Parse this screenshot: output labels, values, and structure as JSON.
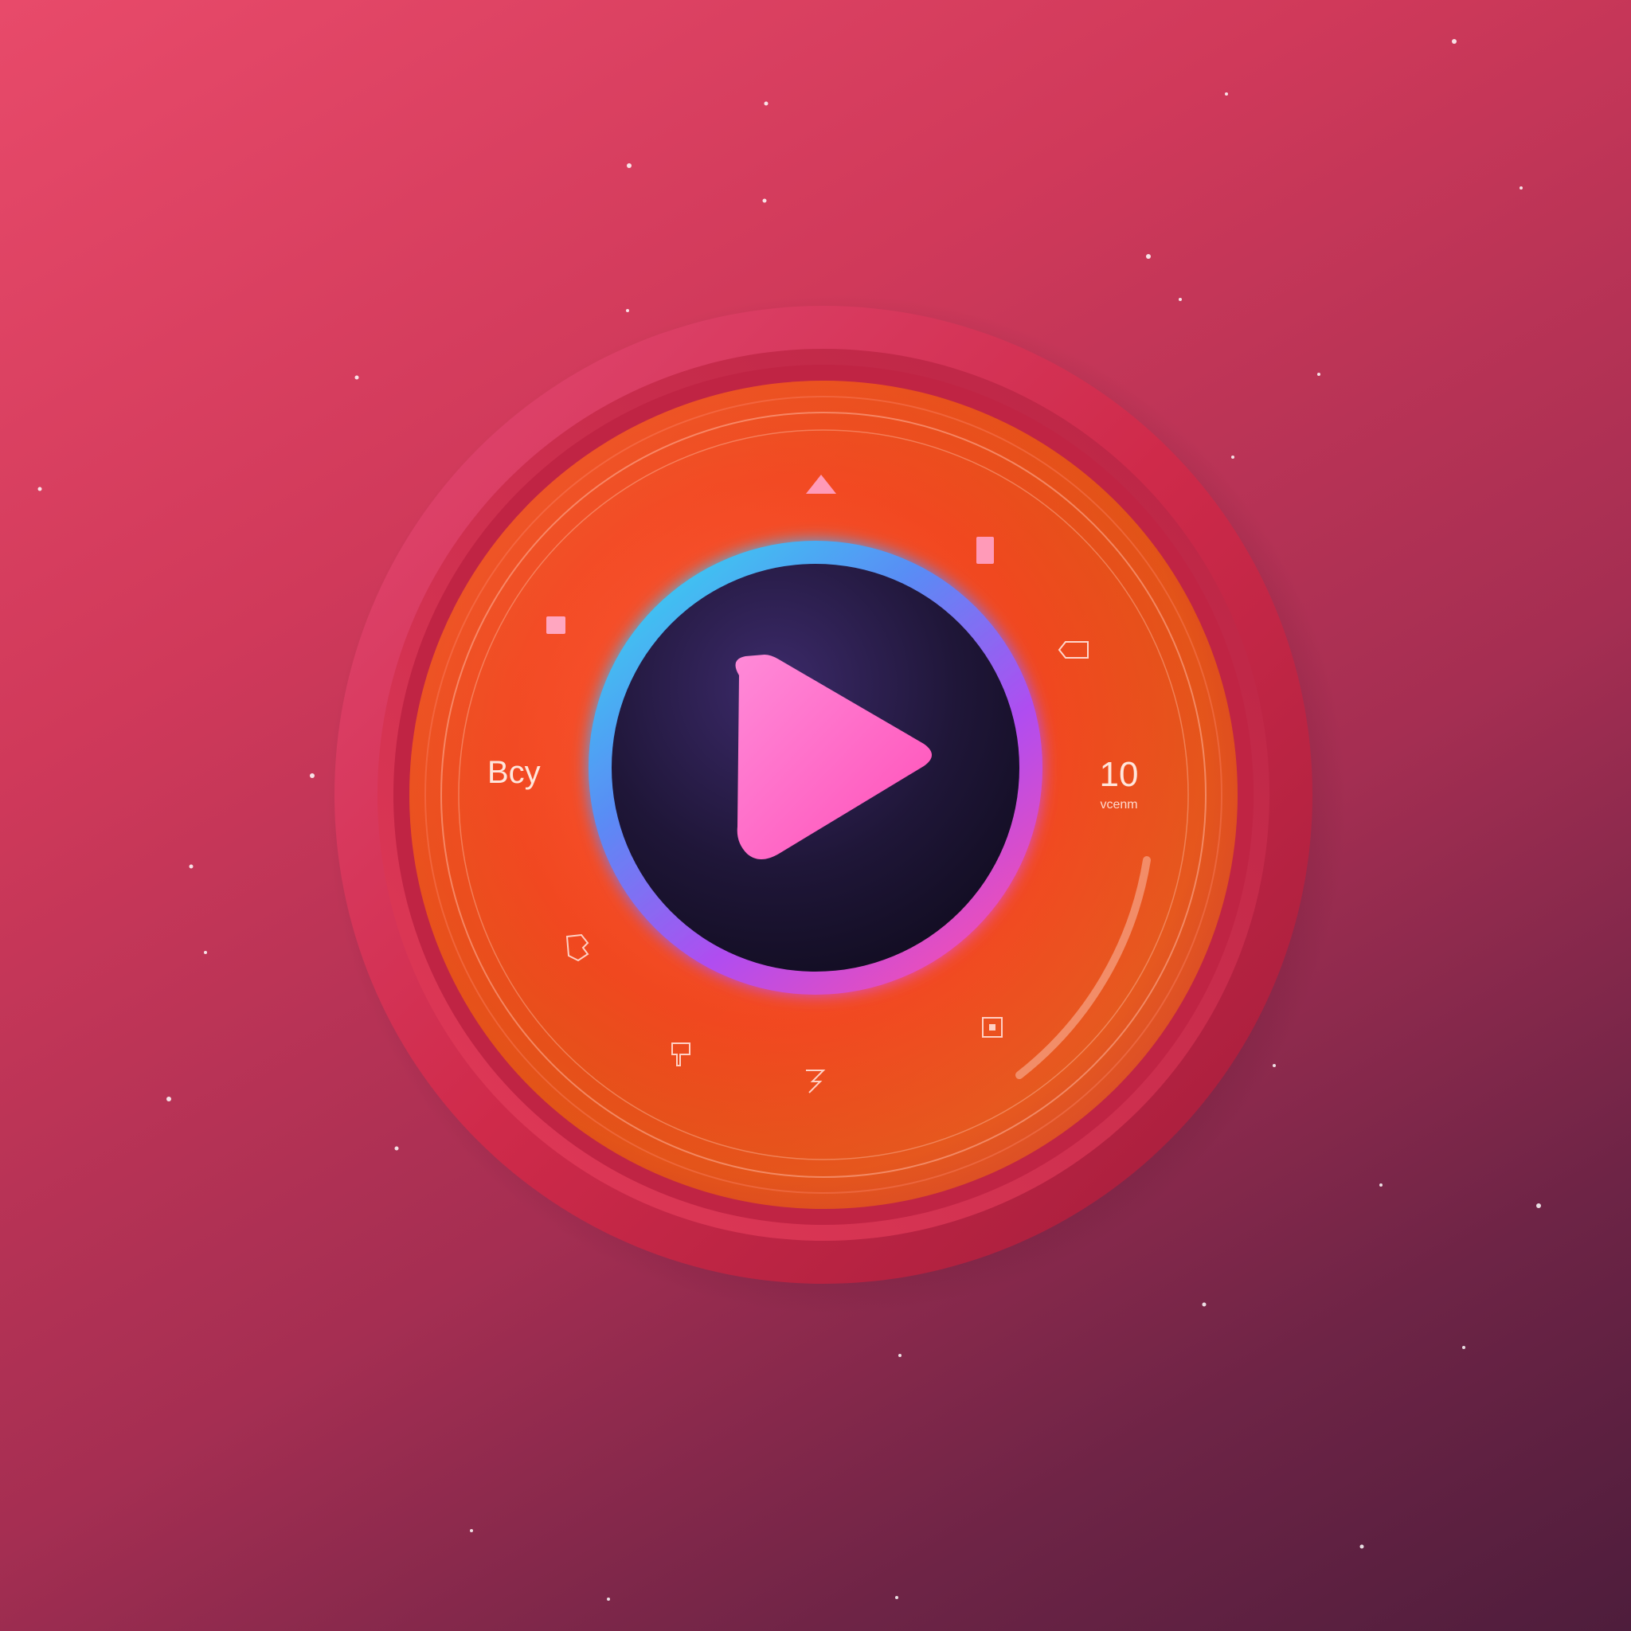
{
  "dial": {
    "left_label": "Bcy",
    "right_value": "10",
    "right_sub_label": "vcenm"
  },
  "colors": {
    "background_top": "#e84a6a",
    "background_bottom": "#4e1d3c",
    "outer_ring": "#c8284a",
    "inner_disc": "#f0522a",
    "play_ring_start": "#35d8f0",
    "play_ring_end": "#ff4fa8",
    "play_center": "#1b1430",
    "play_triangle": "#ff6ec7"
  },
  "icons": {
    "top_marker": "triangle-up-icon",
    "play": "play-icon"
  }
}
